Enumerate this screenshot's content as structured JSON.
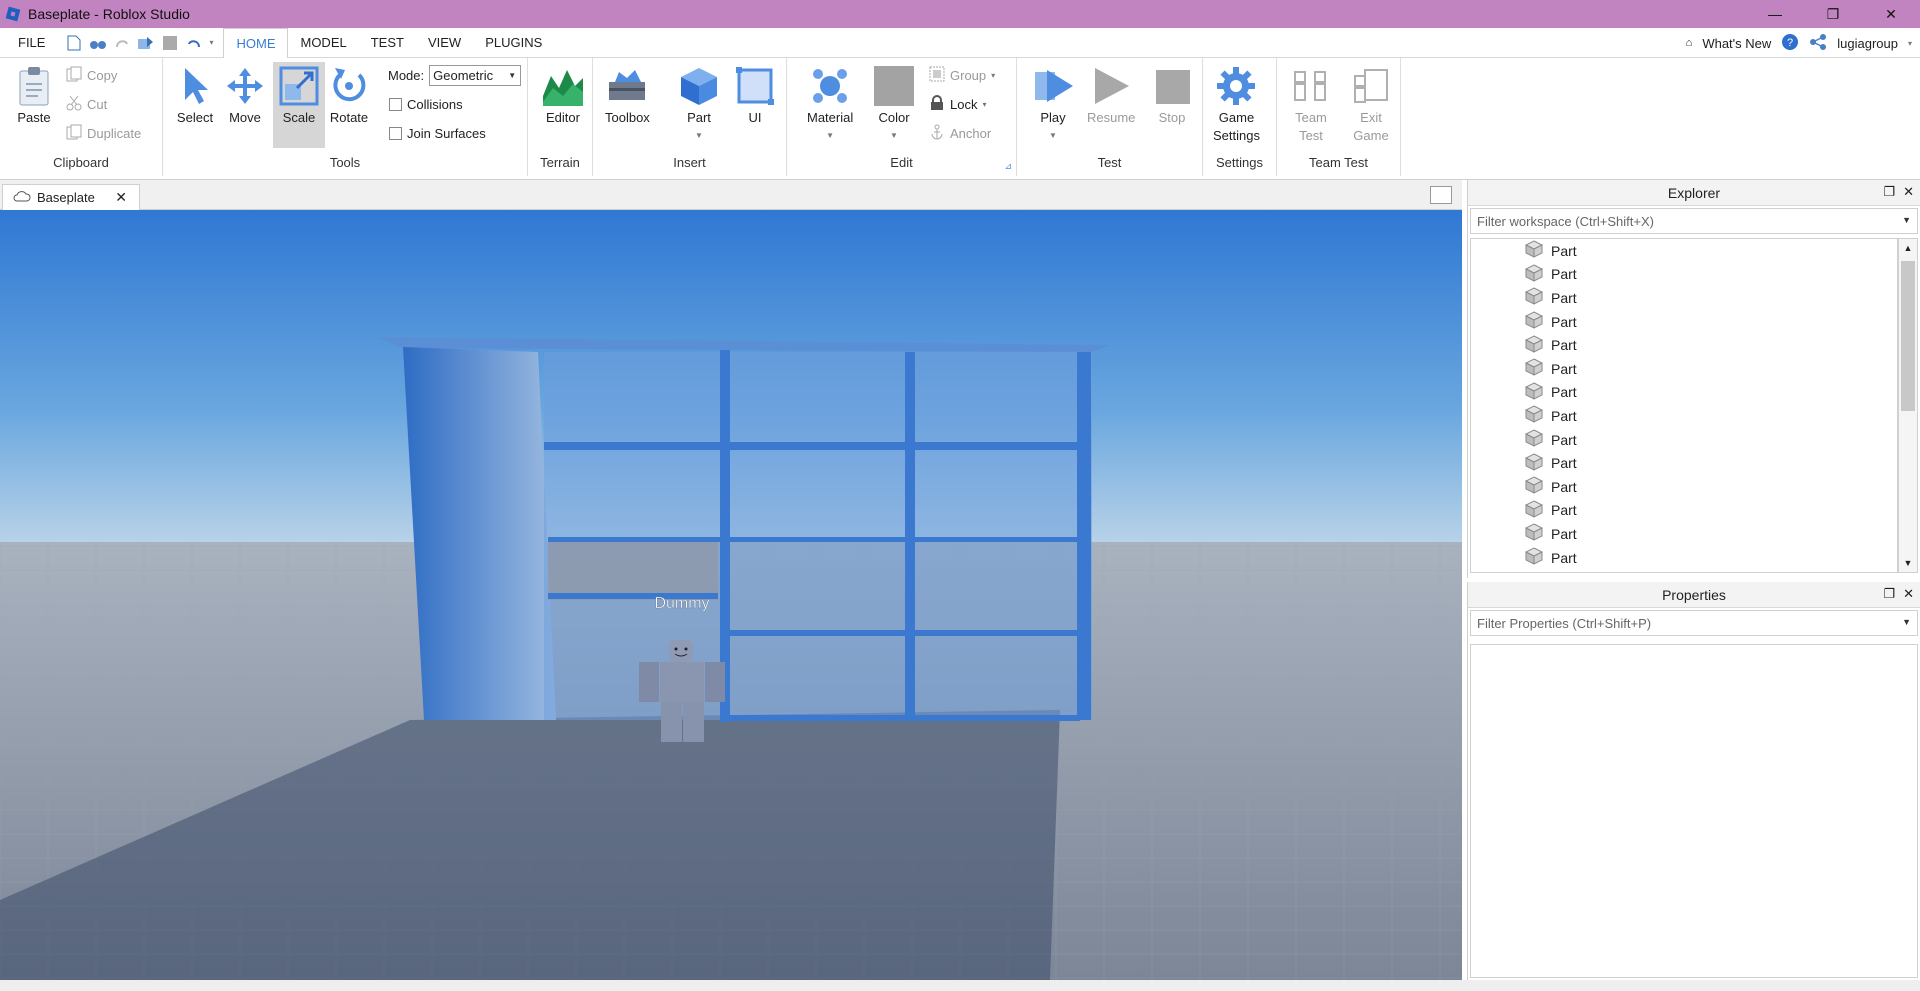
{
  "window": {
    "title": "Baseplate - Roblox Studio",
    "controls": [
      "—",
      "❐",
      "✕"
    ]
  },
  "menubar": {
    "file": "FILE",
    "tabs": [
      "HOME",
      "MODEL",
      "TEST",
      "VIEW",
      "PLUGINS"
    ],
    "active_tab": "HOME",
    "whats_new": "What's New",
    "username": "lugiagroup"
  },
  "ribbon": {
    "clipboard": {
      "label": "Clipboard",
      "paste": "Paste",
      "copy": "Copy",
      "cut": "Cut",
      "duplicate": "Duplicate"
    },
    "tools": {
      "label": "Tools",
      "select": "Select",
      "move": "Move",
      "scale": "Scale",
      "rotate": "Rotate",
      "mode_label": "Mode:",
      "mode_value": "Geometric",
      "collisions": "Collisions",
      "join_surfaces": "Join Surfaces"
    },
    "terrain": {
      "label": "Terrain",
      "editor": "Editor"
    },
    "insert": {
      "label": "Insert",
      "toolbox": "Toolbox",
      "part": "Part",
      "ui": "UI"
    },
    "edit": {
      "label": "Edit",
      "material": "Material",
      "color": "Color",
      "group": "Group",
      "lock": "Lock",
      "anchor": "Anchor"
    },
    "test": {
      "label": "Test",
      "play": "Play",
      "resume": "Resume",
      "stop": "Stop"
    },
    "settings": {
      "label": "Settings",
      "game_settings_1": "Game",
      "game_settings_2": "Settings"
    },
    "team_test": {
      "label": "Team Test",
      "team_1": "Team",
      "team_2": "Test",
      "exit_1": "Exit",
      "exit_2": "Game"
    }
  },
  "document": {
    "tab_label": "Baseplate"
  },
  "viewport": {
    "character_name": "Dummy"
  },
  "explorer": {
    "title": "Explorer",
    "filter_placeholder": "Filter workspace (Ctrl+Shift+X)",
    "items": [
      "Part",
      "Part",
      "Part",
      "Part",
      "Part",
      "Part",
      "Part",
      "Part",
      "Part",
      "Part",
      "Part",
      "Part",
      "Part",
      "Part"
    ]
  },
  "properties": {
    "title": "Properties",
    "filter_placeholder": "Filter Properties (Ctrl+Shift+P)"
  },
  "colors": {
    "titlebar": "#c284c0",
    "accent": "#3a7bd5",
    "sky_top": "#2f78d3",
    "ground": "#8a94a4"
  }
}
